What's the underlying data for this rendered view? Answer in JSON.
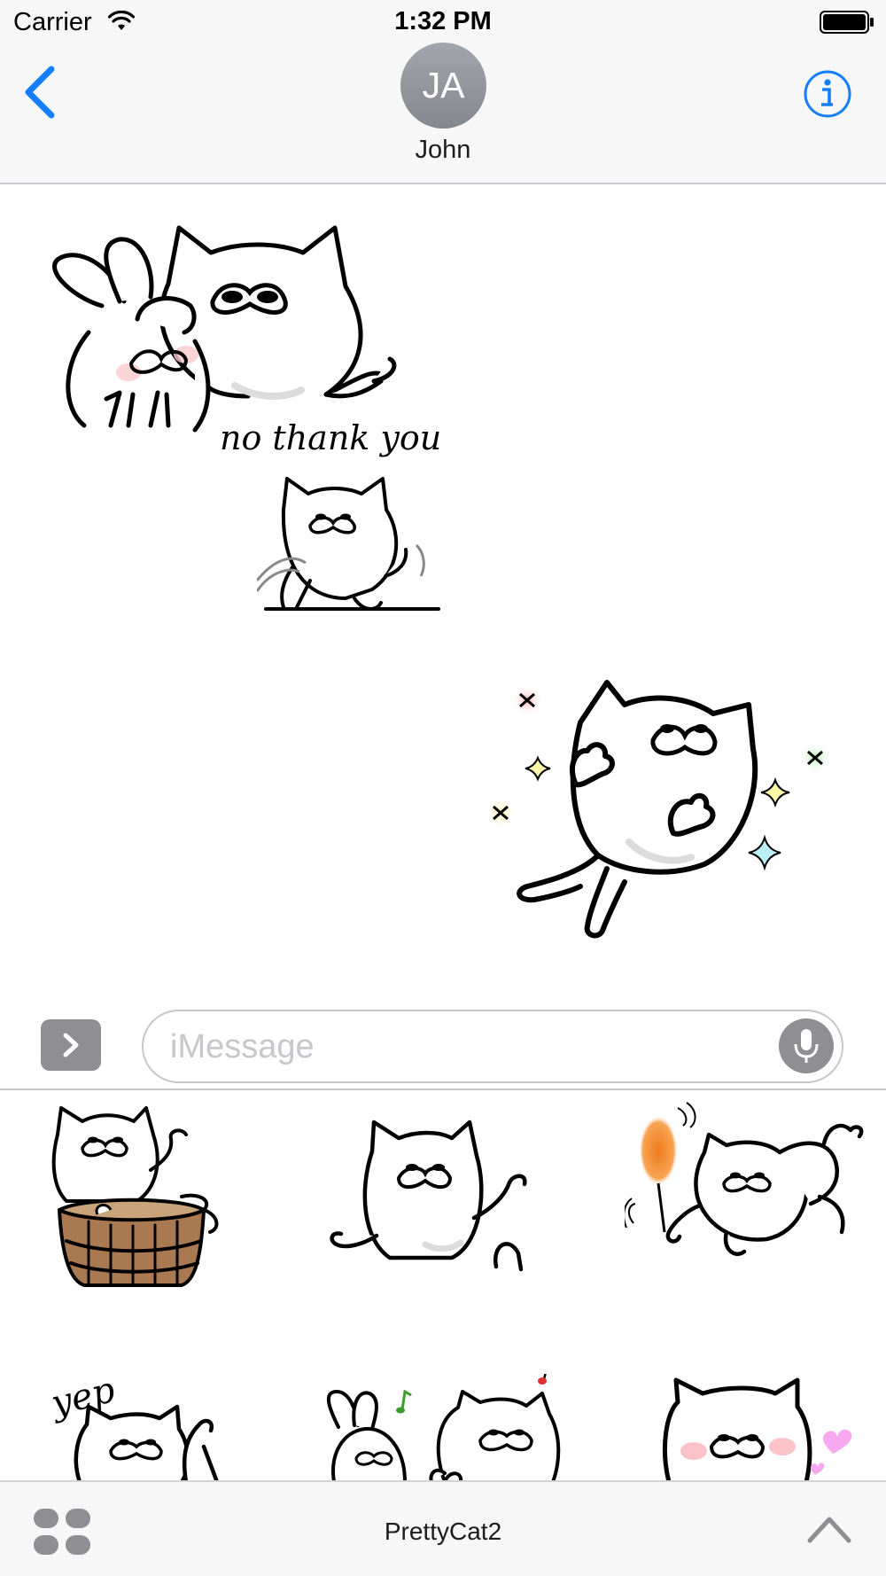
{
  "status_bar": {
    "carrier": "Carrier",
    "time": "1:32 PM"
  },
  "header": {
    "avatar_initials": "JA",
    "contact_name": "John",
    "accent_color": "#147efb"
  },
  "conversation": {
    "stickers": [
      {
        "name": "cat-and-bunny-sticker",
        "caption": "no thank you"
      },
      {
        "name": "cat-waving-sticker",
        "caption": ""
      },
      {
        "name": "cat-jumping-sparkles-sticker",
        "caption": ""
      }
    ]
  },
  "compose": {
    "placeholder": "iMessage"
  },
  "drawer": {
    "stickers": [
      {
        "name": "cat-in-barrel-sticker",
        "caption": ""
      },
      {
        "name": "cat-cheering-sticker",
        "caption": ""
      },
      {
        "name": "cat-with-torch-sticker",
        "caption": ""
      },
      {
        "name": "cat-yep-sticker",
        "caption": "yep"
      },
      {
        "name": "bunny-and-cat-singing-sticker",
        "caption": ""
      },
      {
        "name": "cat-blushing-heart-sticker",
        "caption": ""
      }
    ]
  },
  "app_bar": {
    "app_name": "PrettyCat2"
  }
}
